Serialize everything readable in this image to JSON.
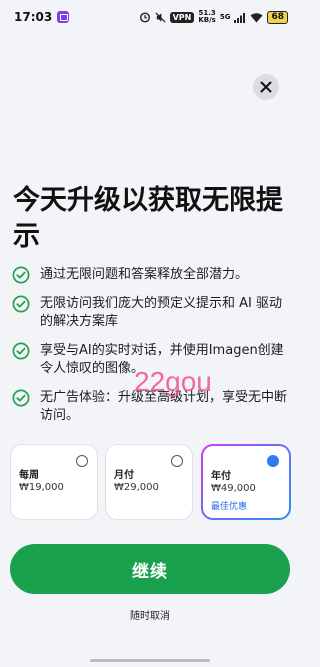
{
  "status_bar": {
    "time": "17:03",
    "vpn": "VPN",
    "speed_top": "51.3",
    "speed_bottom": "KB/s",
    "network": "5G",
    "battery": "68"
  },
  "headline": "今天升级以获取无限提示",
  "features": [
    "通过无限问题和答案释放全部潜力。",
    "无限访问我们庞大的预定义提示和 AI 驱动的解决方案库",
    "享受与AI的实时对话，并使用Imagen创建令人惊叹的图像。",
    "无广告体验：升级至高级计划，享受无中断访问。"
  ],
  "watermark": "22gou",
  "plans": {
    "weekly": {
      "name": "每周",
      "price": "₩19,000"
    },
    "monthly": {
      "name": "月付",
      "price": "₩29,000"
    },
    "annual": {
      "name": "年付",
      "price": "₩49,000",
      "badge": "最佳优惠"
    },
    "selected": "annual"
  },
  "continue_label": "继续",
  "cancel_label": "随时取消",
  "colors": {
    "accent_green": "#1aa14d",
    "check_green": "#22a34b",
    "selected_blue": "#2d7bf0",
    "watermark_pink": "#f03a86"
  },
  "icons": {
    "close": "close-icon",
    "check": "check-circle-icon",
    "app": "app-indicator-icon"
  }
}
